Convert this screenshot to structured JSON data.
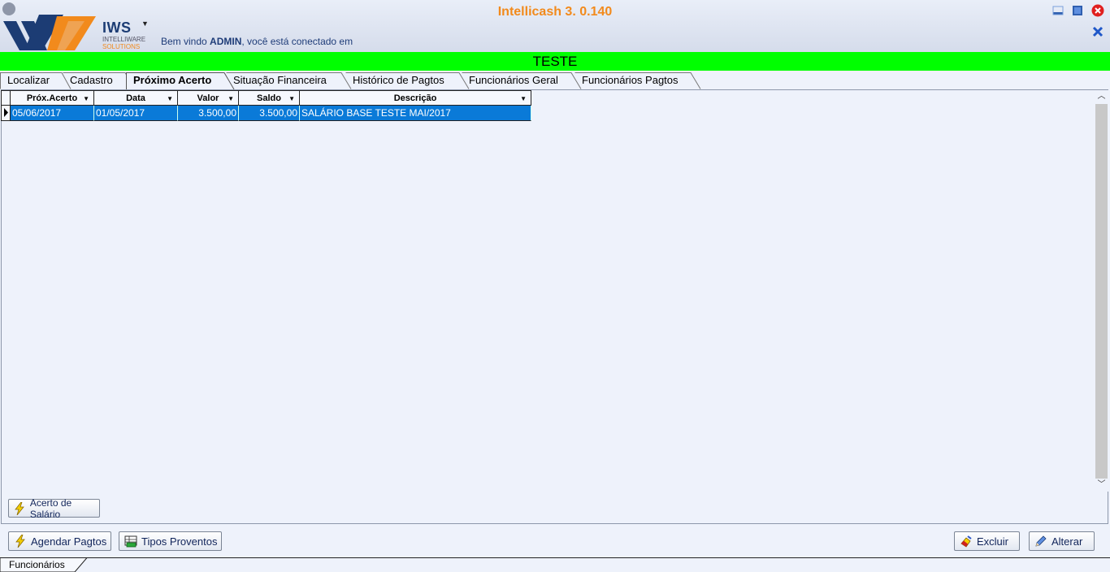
{
  "window": {
    "title": "Intellicash 3. 0.140",
    "welcome_prefix": "Bem vindo ",
    "welcome_user": "ADMIN",
    "welcome_suffix": ", você está conectado em"
  },
  "logo": {
    "word": "IWS",
    "line1": "INTELLIWARE",
    "line2": "SOLUTIONS"
  },
  "record": {
    "name": "TESTE"
  },
  "tabs": [
    {
      "label": "Localizar"
    },
    {
      "label": "Cadastro"
    },
    {
      "label": "Próximo Acerto",
      "active": true
    },
    {
      "label": "Situação Financeira"
    },
    {
      "label": "Histórico de Pagtos"
    },
    {
      "label": "Funcionários Geral"
    },
    {
      "label": "Funcionários Pagtos"
    }
  ],
  "grid": {
    "columns": [
      "Próx.Acerto",
      "Data",
      "Valor",
      "Saldo",
      "Descrição"
    ],
    "rows": [
      [
        "05/06/2017",
        "01/05/2017",
        "3.500,00",
        "3.500,00",
        "SALÁRIO BASE TESTE MAI/2017"
      ]
    ]
  },
  "buttons": {
    "acerto_salario": "Acerto de Salário",
    "agendar_pagtos": "Agendar Pagtos",
    "tipos_proventos": "Tipos Proventos",
    "excluir": "Excluir",
    "alterar": "Alterar"
  },
  "bottom_tab": {
    "label": "Funcionários"
  },
  "colors": {
    "record_bar": "#00ff00",
    "title": "#f28a1c",
    "row_selected": "#0a7ad8"
  }
}
